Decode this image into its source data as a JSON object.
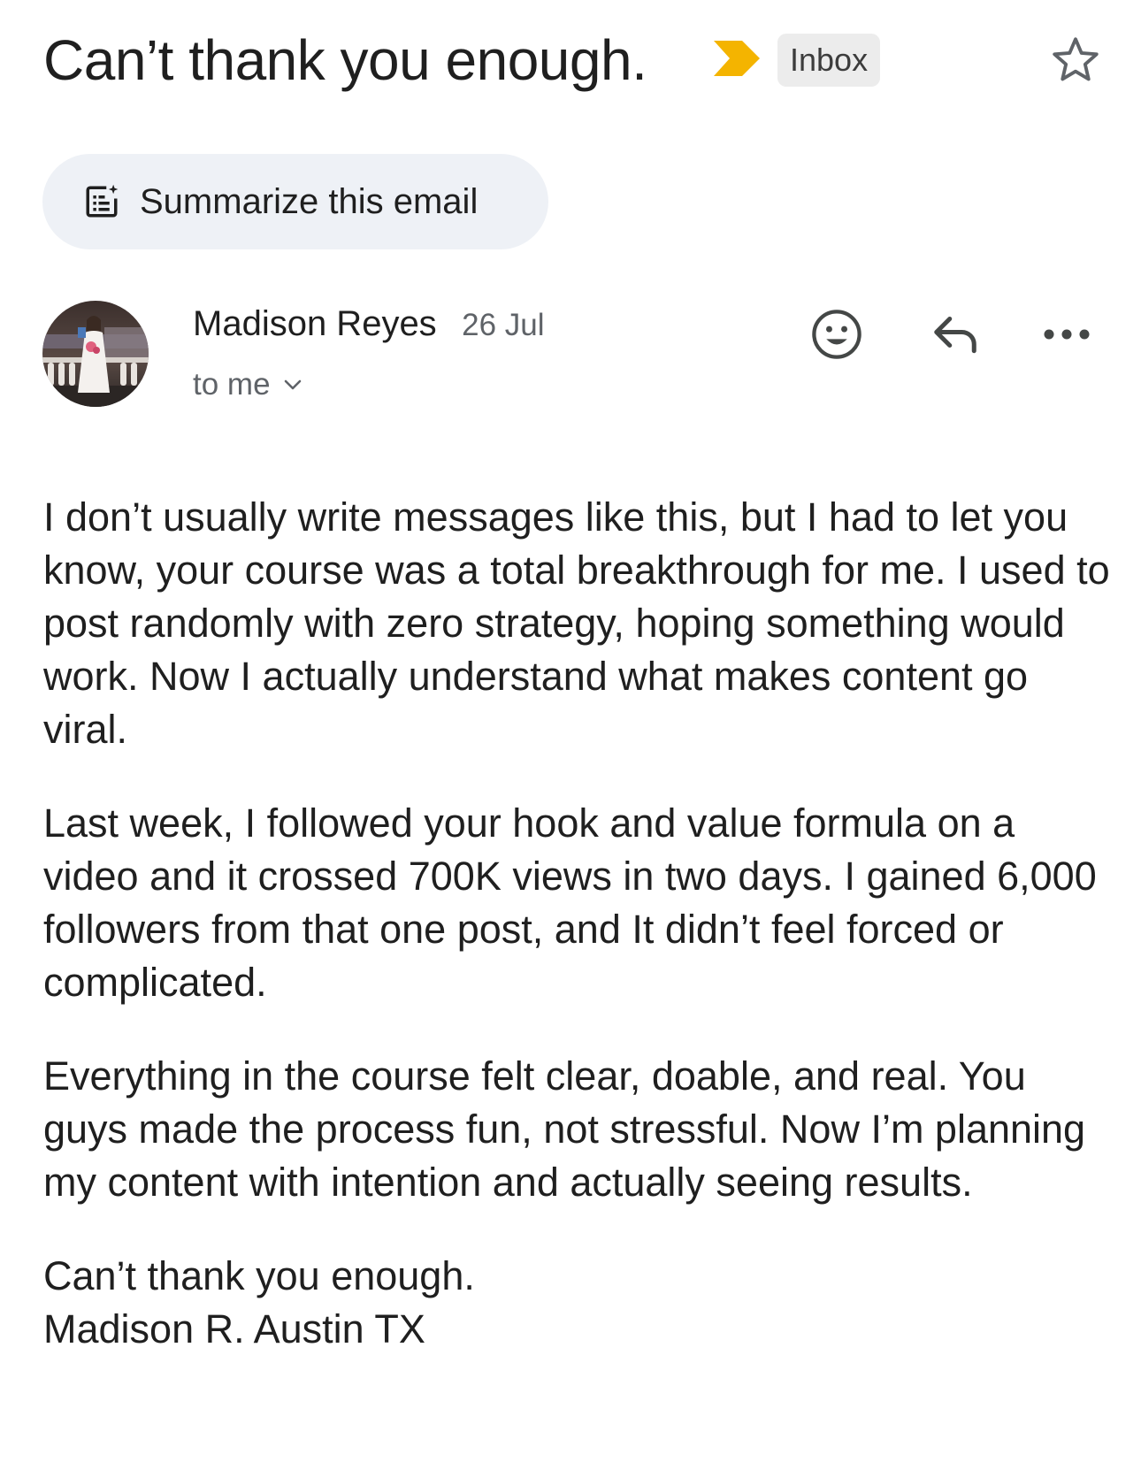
{
  "email": {
    "subject": "Can’t thank you enough.",
    "label": "Inbox",
    "summarize_label": "Summarize this email",
    "sender_name": "Madison Reyes",
    "date": "26 Jul",
    "recipient": "to me",
    "body": {
      "paragraphs": [
        "I don’t usually write messages like this, but I had to let you know, your course was a total breakthrough for me. I used to post randomly with zero strategy, hoping something would work. Now I actually understand what makes content go viral.",
        "Last week, I followed your hook and value formula on a video and it crossed 700K views in two days. I gained 6,000 followers from that one post, and It didn’t feel forced or complicated.",
        "Everything in the course felt clear, doable, and real. You guys made the process fun, not stressful. Now I’m planning my content with intention and actually seeing results."
      ],
      "signoff": "Can’t thank you enough.",
      "signature": "Madison R. Austin TX"
    }
  },
  "icons": {
    "importance": "important-marker-icon",
    "star": "star-icon",
    "summarize": "summarize-sparkle-icon",
    "chevron": "chevron-down-icon",
    "emoji": "emoji-reaction-icon",
    "reply": "reply-icon",
    "more": "more-horizontal-icon"
  },
  "colors": {
    "importance_marker": "#f4b400",
    "chip_background": "#ececec",
    "summarize_background": "#eef1f6",
    "secondary_text": "#5f6368"
  }
}
